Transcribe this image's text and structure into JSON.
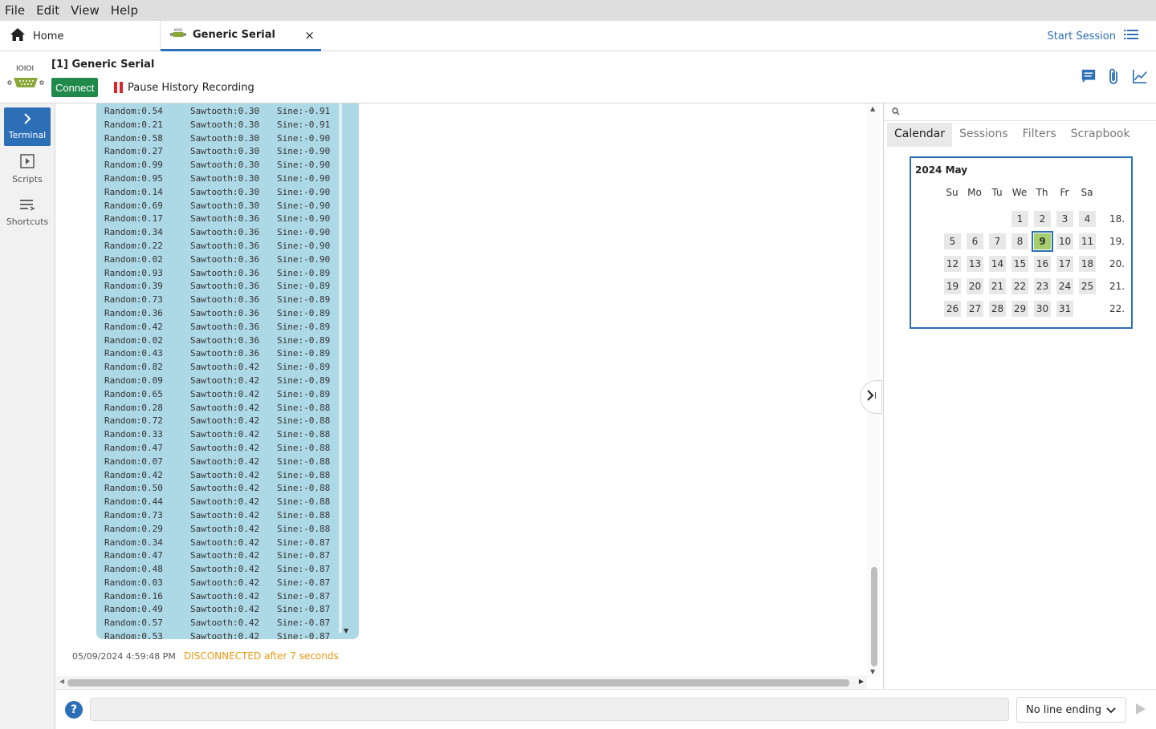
{
  "menu": [
    "File",
    "Edit",
    "View",
    "Help"
  ],
  "tabs": {
    "home": "Home",
    "serial": "Generic Serial",
    "close_glyph": "×"
  },
  "start_session": "Start Session",
  "device": {
    "title": "[1] Generic Serial",
    "connect": "Connect",
    "pause": "Pause History Recording",
    "icon_label": "IOIOI"
  },
  "sidebar": [
    {
      "label": "Terminal",
      "icon": "chevron-right-icon",
      "active": true
    },
    {
      "label": "Scripts",
      "icon": "play-box-icon",
      "active": false
    },
    {
      "label": "Shortcuts",
      "icon": "list-lines-icon",
      "active": false
    }
  ],
  "terminal": {
    "lines": [
      [
        "Random:0.54",
        "Sawtooth:0.30",
        "Sine:-0.91"
      ],
      [
        "Random:0.21",
        "Sawtooth:0.30",
        "Sine:-0.91"
      ],
      [
        "Random:0.58",
        "Sawtooth:0.30",
        "Sine:-0.90"
      ],
      [
        "Random:0.27",
        "Sawtooth:0.30",
        "Sine:-0.90"
      ],
      [
        "Random:0.99",
        "Sawtooth:0.30",
        "Sine:-0.90"
      ],
      [
        "Random:0.95",
        "Sawtooth:0.30",
        "Sine:-0.90"
      ],
      [
        "Random:0.14",
        "Sawtooth:0.30",
        "Sine:-0.90"
      ],
      [
        "Random:0.69",
        "Sawtooth:0.30",
        "Sine:-0.90"
      ],
      [
        "Random:0.17",
        "Sawtooth:0.36",
        "Sine:-0.90"
      ],
      [
        "Random:0.34",
        "Sawtooth:0.36",
        "Sine:-0.90"
      ],
      [
        "Random:0.22",
        "Sawtooth:0.36",
        "Sine:-0.90"
      ],
      [
        "Random:0.02",
        "Sawtooth:0.36",
        "Sine:-0.90"
      ],
      [
        "Random:0.93",
        "Sawtooth:0.36",
        "Sine:-0.89"
      ],
      [
        "Random:0.39",
        "Sawtooth:0.36",
        "Sine:-0.89"
      ],
      [
        "Random:0.73",
        "Sawtooth:0.36",
        "Sine:-0.89"
      ],
      [
        "Random:0.36",
        "Sawtooth:0.36",
        "Sine:-0.89"
      ],
      [
        "Random:0.42",
        "Sawtooth:0.36",
        "Sine:-0.89"
      ],
      [
        "Random:0.02",
        "Sawtooth:0.36",
        "Sine:-0.89"
      ],
      [
        "Random:0.43",
        "Sawtooth:0.36",
        "Sine:-0.89"
      ],
      [
        "Random:0.82",
        "Sawtooth:0.42",
        "Sine:-0.89"
      ],
      [
        "Random:0.09",
        "Sawtooth:0.42",
        "Sine:-0.89"
      ],
      [
        "Random:0.65",
        "Sawtooth:0.42",
        "Sine:-0.89"
      ],
      [
        "Random:0.28",
        "Sawtooth:0.42",
        "Sine:-0.88"
      ],
      [
        "Random:0.72",
        "Sawtooth:0.42",
        "Sine:-0.88"
      ],
      [
        "Random:0.33",
        "Sawtooth:0.42",
        "Sine:-0.88"
      ],
      [
        "Random:0.47",
        "Sawtooth:0.42",
        "Sine:-0.88"
      ],
      [
        "Random:0.07",
        "Sawtooth:0.42",
        "Sine:-0.88"
      ],
      [
        "Random:0.42",
        "Sawtooth:0.42",
        "Sine:-0.88"
      ],
      [
        "Random:0.50",
        "Sawtooth:0.42",
        "Sine:-0.88"
      ],
      [
        "Random:0.44",
        "Sawtooth:0.42",
        "Sine:-0.88"
      ],
      [
        "Random:0.73",
        "Sawtooth:0.42",
        "Sine:-0.88"
      ],
      [
        "Random:0.29",
        "Sawtooth:0.42",
        "Sine:-0.88"
      ],
      [
        "Random:0.34",
        "Sawtooth:0.42",
        "Sine:-0.87"
      ],
      [
        "Random:0.47",
        "Sawtooth:0.42",
        "Sine:-0.87"
      ],
      [
        "Random:0.48",
        "Sawtooth:0.42",
        "Sine:-0.87"
      ],
      [
        "Random:0.03",
        "Sawtooth:0.42",
        "Sine:-0.87"
      ],
      [
        "Random:0.16",
        "Sawtooth:0.42",
        "Sine:-0.87"
      ],
      [
        "Random:0.49",
        "Sawtooth:0.42",
        "Sine:-0.87"
      ],
      [
        "Random:0.57",
        "Sawtooth:0.42",
        "Sine:-0.87"
      ],
      [
        "Random:0.53",
        "Sawtooth:0.42",
        "Sine:-0.87"
      ]
    ],
    "status_time": "05/09/2024 4:59:48 PM",
    "status_message": "DISCONNECTED after 7 seconds"
  },
  "panel": {
    "tabs": [
      "Calendar",
      "Sessions",
      "Filters",
      "Scrapbook"
    ],
    "active_tab": "Calendar",
    "calendar": {
      "title": "2024 May",
      "weekdays": [
        "Su",
        "Mo",
        "Tu",
        "We",
        "Th",
        "Fr",
        "Sa"
      ],
      "weeks": [
        {
          "days": [
            "",
            "",
            "",
            "1",
            "2",
            "3",
            "4"
          ],
          "week": "18."
        },
        {
          "days": [
            "5",
            "6",
            "7",
            "8",
            "9",
            "10",
            "11"
          ],
          "week": "19."
        },
        {
          "days": [
            "12",
            "13",
            "14",
            "15",
            "16",
            "17",
            "18"
          ],
          "week": "20."
        },
        {
          "days": [
            "19",
            "20",
            "21",
            "22",
            "23",
            "24",
            "25"
          ],
          "week": "21."
        },
        {
          "days": [
            "26",
            "27",
            "28",
            "29",
            "30",
            "31",
            ""
          ],
          "week": "22."
        }
      ],
      "selected": "9"
    }
  },
  "bottom": {
    "help": "?",
    "line_ending": "No line ending"
  },
  "colors": {
    "accent": "#2c6fb7",
    "connect": "#1f8a4c",
    "terminal_bg": "#add8e6",
    "status": "#e89a14",
    "selected_day": "#a6cf6b"
  }
}
